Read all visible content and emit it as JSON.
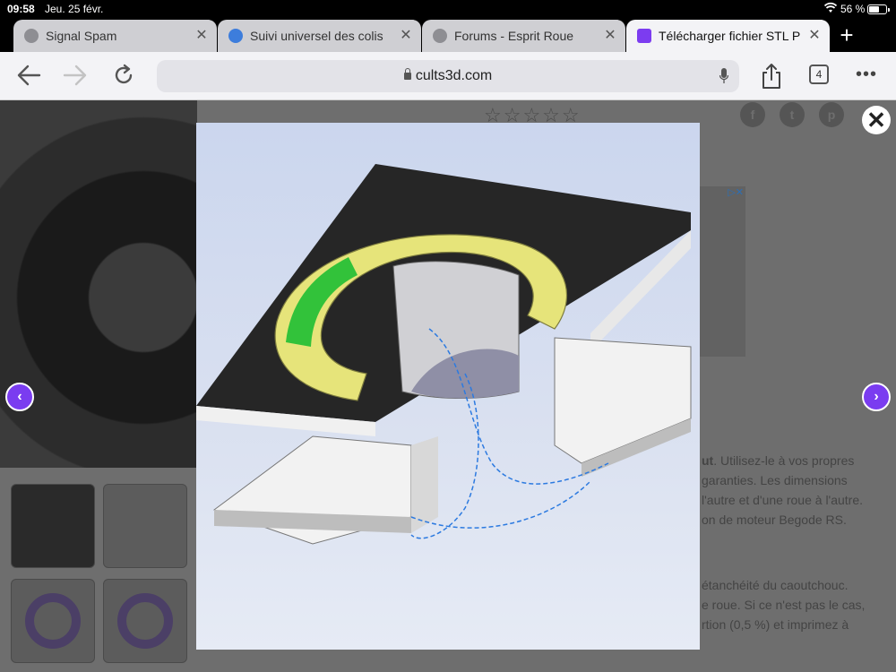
{
  "status_bar": {
    "time": "09:58",
    "date": "Jeu. 25 févr.",
    "battery": "56 %"
  },
  "tabs": [
    {
      "label": "Signal Spam",
      "icon": "globe-icon",
      "active": false
    },
    {
      "label": "Suivi universel des colis",
      "icon": "suivi-favicon-icon",
      "active": false
    },
    {
      "label": "Forums - Esprit Roue",
      "icon": "globe-icon",
      "active": false
    },
    {
      "label": "Télécharger fichier STL P",
      "icon": "cults-favicon-icon",
      "active": true
    }
  ],
  "toolbar": {
    "url": "cults3d.com",
    "tab_count": "4"
  },
  "background_page": {
    "description_lines": [
      {
        "text": "ut. Utilisez-le à vos propres",
        "bold_prefix": "ut"
      },
      {
        "text": "garanties. Les dimensions"
      },
      {
        "text": "l'autre et d'une roue à l'autre."
      },
      {
        "text": "on de moteur Begode RS."
      },
      {
        "text": "étanchéité du caoutchouc."
      },
      {
        "text": "e roue. Si ce n'est pas le cas,"
      },
      {
        "text": "rtion (0,5 %) et imprimez à"
      }
    ]
  },
  "colors": {
    "accent": "#7a3cf0",
    "overlay": "#6e6e6e",
    "toolbar_bg": "#f3f3f6"
  }
}
